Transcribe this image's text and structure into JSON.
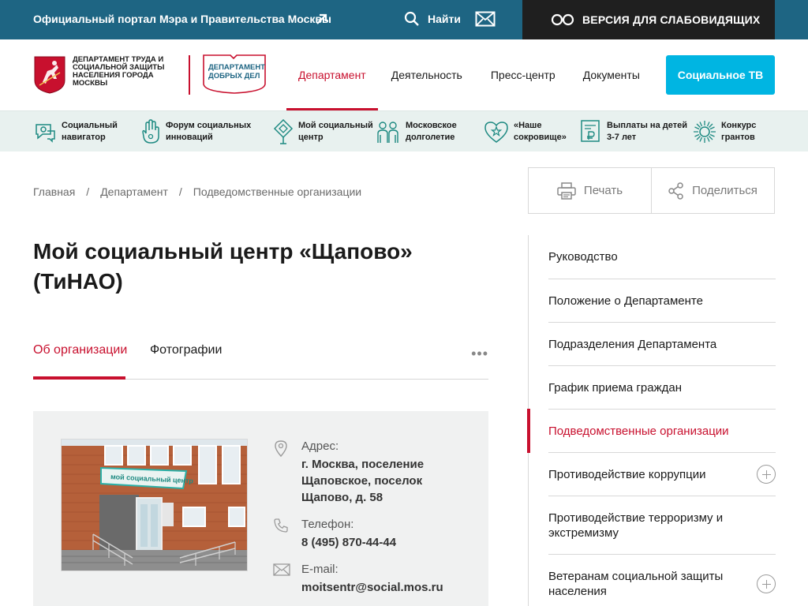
{
  "topbar": {
    "portal_label": "Официальный портал Мэра и Правительства Москвы",
    "search_label": "Найти",
    "blind_version_label": "ВЕРСИЯ ДЛЯ СЛАБОВИДЯЩИХ"
  },
  "header": {
    "logo_text": "ДЕПАРТАМЕНТ ТРУДА И СОЦИАЛЬНОЙ ЗАЩИТЫ НАСЕЛЕНИЯ ГОРОДА МОСКВЫ",
    "logo2_line1": "ДЕПАРТАМЕНТ",
    "logo2_line2": "ДОБРЫХ ДЕЛ",
    "nav": [
      {
        "label": "Департамент",
        "active": true
      },
      {
        "label": "Деятельность",
        "active": false
      },
      {
        "label": "Пресс-центр",
        "active": false
      },
      {
        "label": "Документы",
        "active": false
      }
    ],
    "social_tv_label": "Социальное ТВ"
  },
  "services": [
    {
      "label": "Социальный навигатор",
      "icon": "navigator-icon"
    },
    {
      "label": "Форум социальных инноваций",
      "icon": "hand-icon"
    },
    {
      "label": "Мой социальный центр",
      "icon": "social-center-icon"
    },
    {
      "label": "Московское долголетие",
      "icon": "elderly-icon"
    },
    {
      "label": "«Наше сокровище»",
      "icon": "heart-star-icon"
    },
    {
      "label": "Выплаты на детей 3-7 лет",
      "icon": "payment-icon"
    },
    {
      "label": "Конкурс грантов",
      "icon": "sun-icon"
    }
  ],
  "breadcrumbs": [
    "Главная",
    "Департамент",
    "Подведомственные организации"
  ],
  "actions": {
    "print_label": "Печать",
    "share_label": "Поделиться"
  },
  "page": {
    "title": "Мой социальный центр «Щапово» (ТиНАО)"
  },
  "tabs": [
    {
      "label": "Об организации",
      "active": true
    },
    {
      "label": "Фотографии",
      "active": false
    }
  ],
  "tabs_more": "•••",
  "org": {
    "photo_sign": "мой социальный центр",
    "address_label": "Адрес:",
    "address_value": "г. Москва, поселение Щаповское, поселок Щапово, д. 58",
    "phone_label": "Телефон:",
    "phone_value": "8 (495) 870-44-44",
    "email_label": "E-mail:",
    "email_value": "moitsentr@social.mos.ru"
  },
  "sidebar": [
    {
      "label": "Руководство",
      "active": false,
      "expandable": false
    },
    {
      "label": "Положение о Департаменте",
      "active": false,
      "expandable": false
    },
    {
      "label": "Подразделения Департамента",
      "active": false,
      "expandable": false
    },
    {
      "label": "График приема граждан",
      "active": false,
      "expandable": false
    },
    {
      "label": "Подведомственные организации",
      "active": true,
      "expandable": false
    },
    {
      "label": "Противодействие коррупции",
      "active": false,
      "expandable": true
    },
    {
      "label": "Противодействие терроризму и экстремизму",
      "active": false,
      "expandable": false
    },
    {
      "label": "Ветеранам социальной защиты населения",
      "active": false,
      "expandable": true
    }
  ],
  "colors": {
    "accent": "#c8102e",
    "topbar": "#1e6583",
    "cta": "#00b5e2",
    "strip": "#e8f1ef"
  }
}
